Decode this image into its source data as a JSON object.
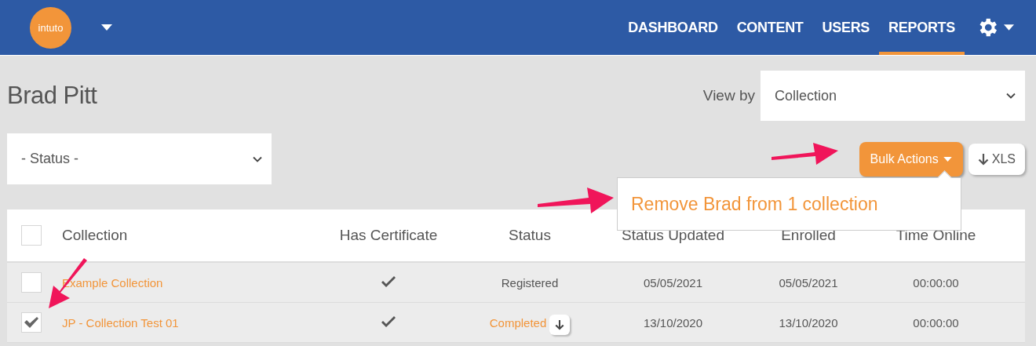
{
  "header": {
    "logo": "intuto",
    "nav": [
      {
        "label": "DASHBOARD",
        "selected": false
      },
      {
        "label": "CONTENT",
        "selected": false
      },
      {
        "label": "USERS",
        "selected": false
      },
      {
        "label": "REPORTS",
        "selected": true
      }
    ]
  },
  "page": {
    "title": "Brad Pitt",
    "view_by": {
      "label": "View by",
      "value": "Collection"
    },
    "status_filter": {
      "value": "- Status -"
    }
  },
  "actions": {
    "bulk": "Bulk Actions",
    "export": "XLS",
    "menu": [
      "Remove Brad from 1 collection"
    ]
  },
  "table": {
    "select_all_checked": false,
    "columns": [
      "Collection",
      "Has Certificate",
      "Status",
      "Status Updated",
      "Enrolled",
      "Time Online"
    ],
    "rows": [
      {
        "checked": false,
        "collection": "Example Collection",
        "has_certificate": true,
        "status": "Registered",
        "kind": "plain",
        "status_updated": "05/05/2021",
        "enrolled": "05/05/2021",
        "time_online": "00:00:00"
      },
      {
        "checked": true,
        "collection": "JP - Collection Test 01",
        "has_certificate": true,
        "status": "Completed",
        "kind": "download",
        "status_updated": "13/10/2020",
        "enrolled": "13/10/2020",
        "time_online": "00:00:00"
      }
    ]
  }
}
